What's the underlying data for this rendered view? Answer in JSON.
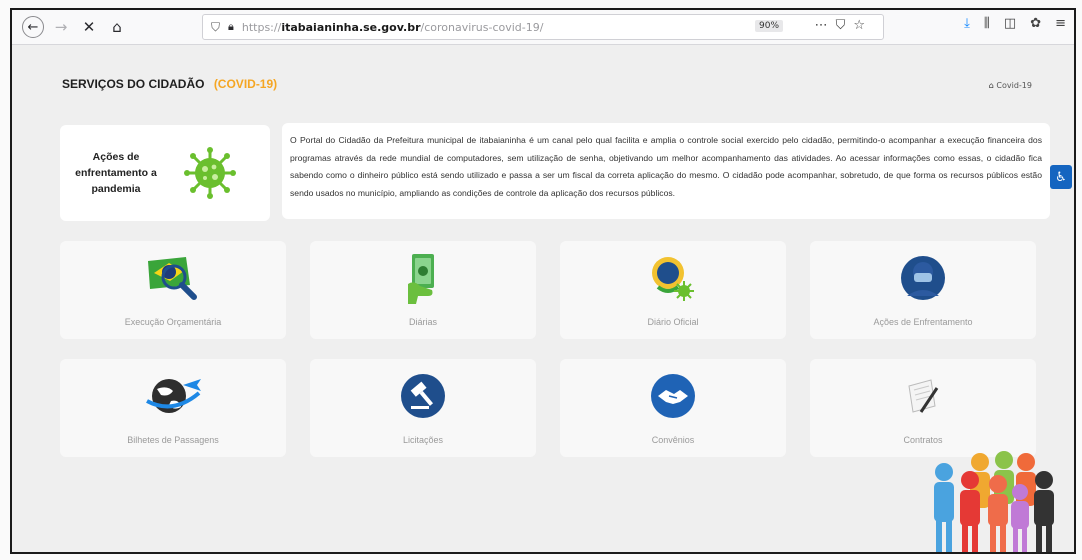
{
  "browser": {
    "url_prefix": "https://",
    "url_domain": "itabaianinha.se.gov.br",
    "url_path": "/coronavirus-covid-19/",
    "zoom": "90%"
  },
  "header": {
    "title": "SERVIÇOS DO CIDADÃO",
    "title_highlight": "(COVID-19)",
    "breadcrumb": "Covid-19"
  },
  "covid_card": {
    "label": "Ações de enfrentamento a pandemia"
  },
  "intro": {
    "text": "O Portal do Cidadão da Prefeitura municipal de itabaianinha é um canal pelo qual facilita e amplia o controle social exercido pelo cidadão, permitindo-o acompanhar a execução financeira dos programas através da rede mundial de computadores, sem utilização de senha, objetivando um melhor acompanhamento das atividades. Ao acessar informações como essas, o cidadão fica sabendo como o dinheiro público está sendo utilizado e passa a ser um fiscal da correta aplicação do mesmo. O cidadão pode acompanhar, sobretudo, de que forma os recursos públicos estão sendo usados no município, ampliando as condições de controle da aplicação dos recursos públicos."
  },
  "tiles": [
    {
      "label": "Execução Orçamentária",
      "icon": "brazil-flag-magnifier-icon"
    },
    {
      "label": "Diárias",
      "icon": "hand-money-icon"
    },
    {
      "label": "Diário Oficial",
      "icon": "brazil-seal-virus-icon"
    },
    {
      "label": "Ações de Enfrentamento",
      "icon": "masked-person-icon"
    },
    {
      "label": "Bilhetes de Passagens",
      "icon": "globe-plane-icon"
    },
    {
      "label": "Licitações",
      "icon": "gavel-icon"
    },
    {
      "label": "Convênios",
      "icon": "handshake-icon"
    },
    {
      "label": "Contratos",
      "icon": "contract-pen-icon"
    }
  ],
  "colors": {
    "accent_orange": "#f5a623",
    "covid_green": "#6abf2e",
    "navy": "#1f4e8c",
    "a11y_blue": "#1565c0"
  }
}
